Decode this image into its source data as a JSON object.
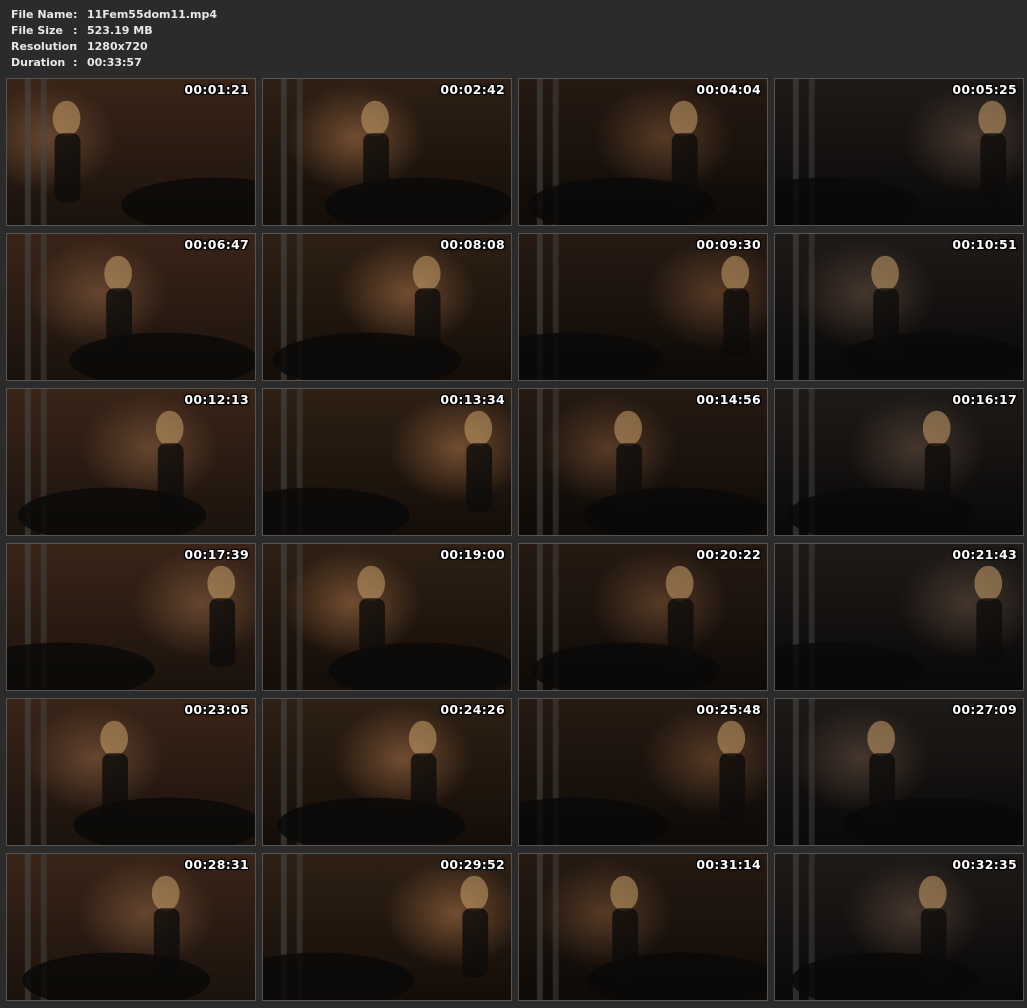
{
  "file_info": {
    "rows": [
      {
        "label": "File Name",
        "sep": ":",
        "value": "11Fem55dom11.mp4"
      },
      {
        "label": "File Size",
        "sep": ":",
        "value": "523.19 MB"
      },
      {
        "label": "Resolution",
        "sep": ":",
        "value": "1280x720"
      },
      {
        "label": "Duration",
        "sep": ":",
        "value": "00:33:57"
      }
    ]
  },
  "thumbnails": [
    {
      "timestamp": "00:01:21"
    },
    {
      "timestamp": "00:02:42"
    },
    {
      "timestamp": "00:04:04"
    },
    {
      "timestamp": "00:05:25"
    },
    {
      "timestamp": "00:06:47"
    },
    {
      "timestamp": "00:08:08"
    },
    {
      "timestamp": "00:09:30"
    },
    {
      "timestamp": "00:10:51"
    },
    {
      "timestamp": "00:12:13"
    },
    {
      "timestamp": "00:13:34"
    },
    {
      "timestamp": "00:14:56"
    },
    {
      "timestamp": "00:16:17"
    },
    {
      "timestamp": "00:17:39"
    },
    {
      "timestamp": "00:19:00"
    },
    {
      "timestamp": "00:20:22"
    },
    {
      "timestamp": "00:21:43"
    },
    {
      "timestamp": "00:23:05"
    },
    {
      "timestamp": "00:24:26"
    },
    {
      "timestamp": "00:25:48"
    },
    {
      "timestamp": "00:27:09"
    },
    {
      "timestamp": "00:28:31"
    },
    {
      "timestamp": "00:29:52"
    },
    {
      "timestamp": "00:31:14"
    },
    {
      "timestamp": "00:32:35"
    }
  ],
  "colors": {
    "background": "#2b2b2b",
    "header_text": "#e8e8e8",
    "timestamp_text": "#ffffff"
  }
}
